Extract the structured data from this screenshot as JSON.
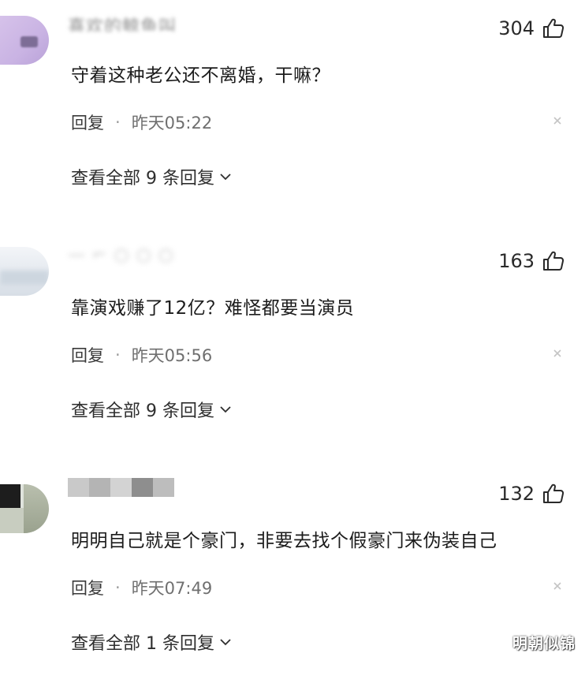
{
  "comments": [
    {
      "username": "喜欢的鲸鱼叫",
      "likes": "304",
      "text": "守着这种老公还不离婚，干嘛？",
      "reply_label": "回复",
      "separator": "·",
      "time": "昨天05:22",
      "view_all": "查看全部 9 条回复"
    },
    {
      "username": "—  ⌐ ○ ○ ○",
      "likes": "163",
      "text": "靠演戏赚了12亿？难怪都要当演员",
      "reply_label": "回复",
      "separator": "·",
      "time": "昨天05:56",
      "view_all": "查看全部 9 条回复"
    },
    {
      "username": "",
      "likes": "132",
      "text": "明明自己就是个豪门，非要去找个假豪门来伪装自己",
      "reply_label": "回复",
      "separator": "·",
      "time": "昨天07:49",
      "view_all": "查看全部 1 条回复"
    }
  ],
  "watermark": "明朝似锦",
  "icons": {
    "like": "thumbs-up-icon",
    "close": "close-icon",
    "expand": "chevron-down-icon"
  }
}
